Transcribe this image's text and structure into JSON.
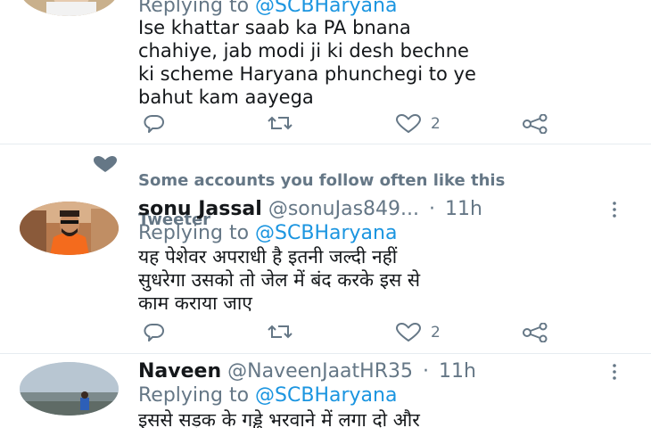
{
  "colors": {
    "link": "#1b95e0",
    "secondary": "#657786",
    "text": "#14171a",
    "divider": "#e6ecf0"
  },
  "social_context": {
    "icon": "heart-icon",
    "text_line1": "Some accounts you follow often like this",
    "text_line2": "Tweeter"
  },
  "tweets": [
    {
      "reply_prefix": "Replying to",
      "reply_mention": "@SCBHaryana",
      "text": "Ise khattar saab ka PA bnana\nchahiye, jab modi ji ki desh bechne\nki scheme Haryana phunchegi to ye\nbahut kam aayega",
      "reply_icon": "reply-icon",
      "retweet_icon": "retweet-icon",
      "like_icon": "heart-outline-icon",
      "like_count": "2",
      "share_icon": "share-icon"
    },
    {
      "name": "sonu Jassal",
      "handle": "@sonuJas849...",
      "separator": "·",
      "time": "11h",
      "reply_prefix": "Replying to",
      "reply_mention": "@SCBHaryana",
      "text": "यह पेशेवर अपराधी है इतनी जल्दी नहीं\nसुधरेगा उसको तो जेल में बंद करके इस से\nकाम कराया जाए",
      "reply_icon": "reply-icon",
      "retweet_icon": "retweet-icon",
      "like_icon": "heart-outline-icon",
      "like_count": "2",
      "share_icon": "share-icon",
      "more_icon": "more-vertical-icon"
    },
    {
      "name": "Naveen",
      "handle": "@NaveenJaatHR35",
      "separator": "·",
      "time": "11h",
      "reply_prefix": "Replying to",
      "reply_mention": "@SCBHaryana",
      "text": "इससे सड़क के गड्ढे भरवाने में लगा दो और",
      "more_icon": "more-vertical-icon"
    }
  ]
}
